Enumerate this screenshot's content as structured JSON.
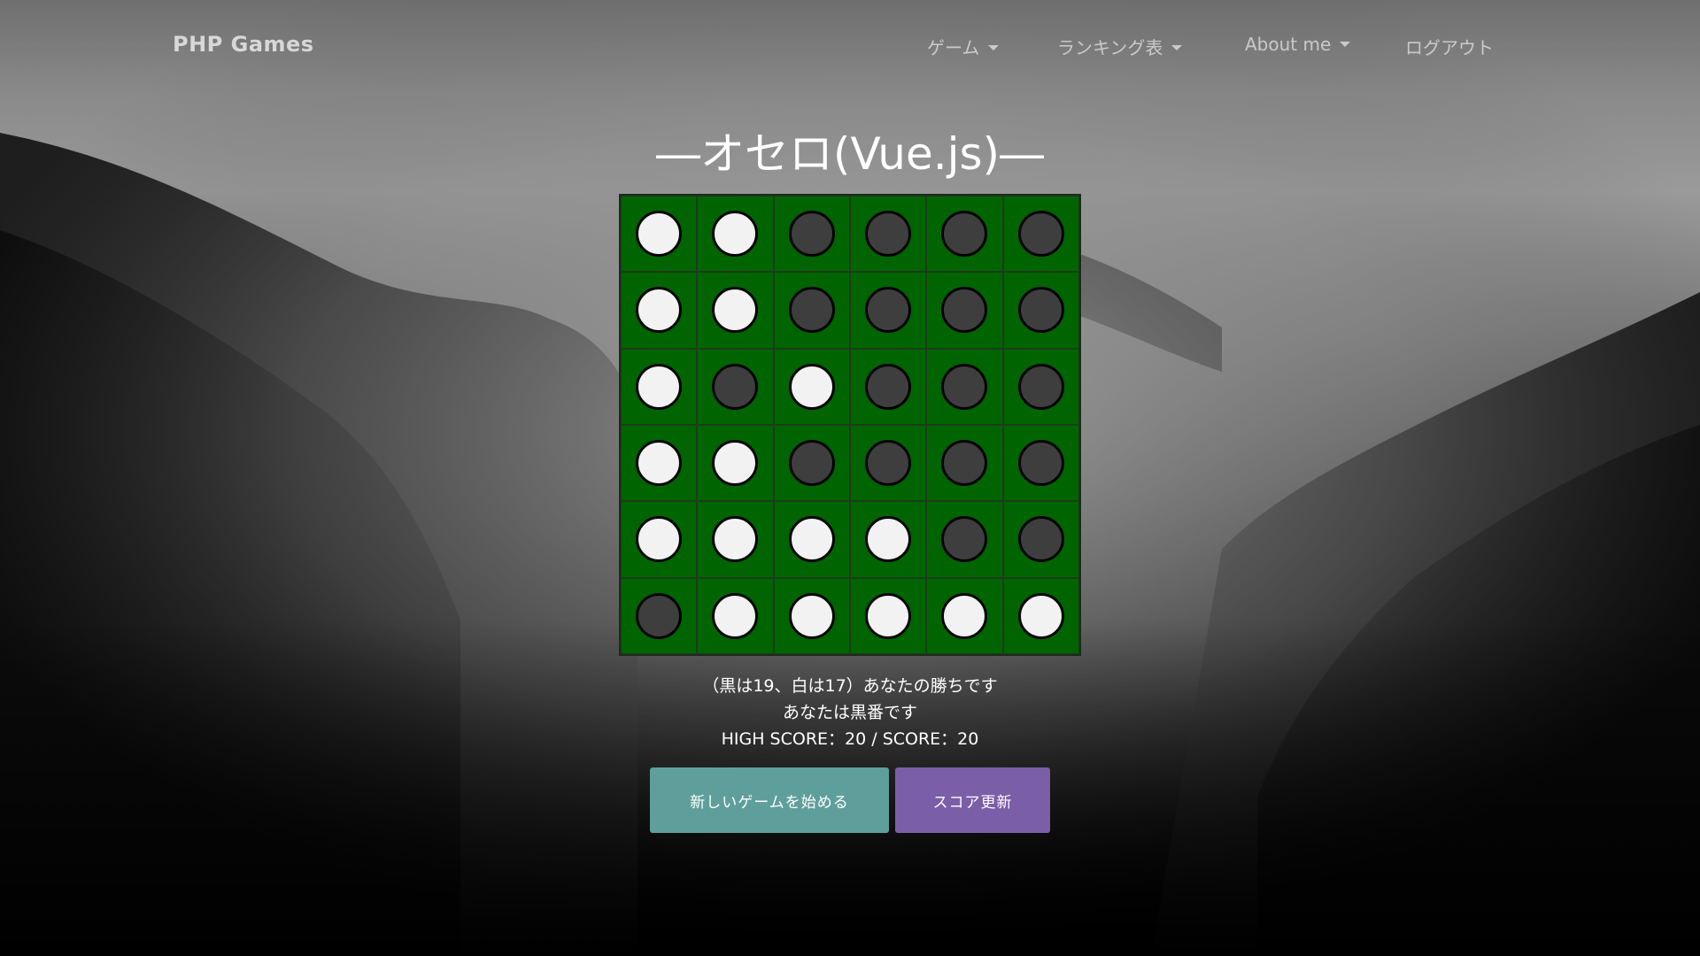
{
  "navbar": {
    "brand": "PHP Games",
    "items": [
      {
        "label": "ゲーム",
        "dropdown": true
      },
      {
        "label": "ランキング表",
        "dropdown": true
      },
      {
        "label": "About me",
        "dropdown": true
      },
      {
        "label": "ログアウト",
        "dropdown": false
      }
    ]
  },
  "title": "―オセロ(Vue.js)―",
  "board": [
    [
      "white",
      "white",
      "black",
      "black",
      "black",
      "black"
    ],
    [
      "white",
      "white",
      "black",
      "black",
      "black",
      "black"
    ],
    [
      "white",
      "black",
      "white",
      "black",
      "black",
      "black"
    ],
    [
      "white",
      "white",
      "black",
      "black",
      "black",
      "black"
    ],
    [
      "white",
      "white",
      "white",
      "white",
      "black",
      "black"
    ],
    [
      "black",
      "white",
      "white",
      "white",
      "white",
      "white"
    ]
  ],
  "status": {
    "result": "（黒は19、白は17）あなたの勝ちです",
    "turn": "あなたは黒番です",
    "score": "HIGH SCORE：20 / SCORE：20"
  },
  "buttons": {
    "new_game": "新しいゲームを始める",
    "update_score": "スコア更新"
  },
  "colors": {
    "board_green": "#006400",
    "stone_white": "#f2f2f2",
    "stone_black": "#3e3e3e",
    "new_game_button": "#5f9f9b",
    "update_score_button": "#7a5fa8"
  }
}
